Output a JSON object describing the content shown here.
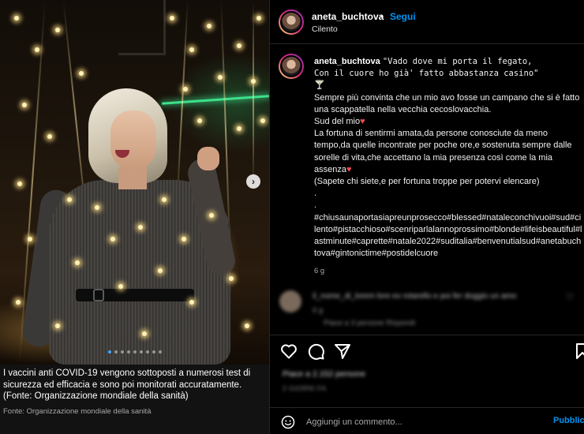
{
  "colors": {
    "background": "#000000",
    "link_blue": "#0095f6",
    "heart_red": "#ed4956",
    "muted_text": "#a8a8a8",
    "divider": "#262626"
  },
  "photo": {
    "description_icon": "carousel-next-icon",
    "carousel_count": 9,
    "carousel_active_index": 0
  },
  "info_banner": {
    "text": "I vaccini anti COVID-19 vengono sottoposti a numerosi test di sicurezza ed efficacia e sono poi monitorati accuratamente. (Fonte: Organizzazione mondiale della sanità)",
    "source": "Fonte: Organizzazione mondiale della sanità"
  },
  "header": {
    "username": "aneta_buchtova",
    "separator": "•",
    "follow_label": "Segui",
    "location": "Cilento"
  },
  "caption": {
    "username": "aneta_buchtova",
    "quote_line1": "\"Vado dove mi porta il fegato,",
    "quote_line2": "Con il cuore ho già' fatto abbastanza casino\"",
    "paragraph1": "Sempre più convinta che un mio avo fosse un campano che si è fatto una scappatella nella vecchia cecoslovacchia.",
    "paragraph2": "Sud del mio",
    "paragraph3": "La fortuna di sentirmi amata,da persone conosciute da meno tempo,da quelle incontrate per poche ore,e sostenuta sempre dalle sorelle di vita,che accettano la mia presenza così come la mia assenza",
    "paragraph4": "(Sapete chi siete,e per fortuna troppe per potervi elencare)",
    "dot1": ".",
    "dot2": ".",
    "hashtags": "#chiusaunaportasiapreunprosecco#blessed#nataleconchivuoi#sud#cilento#pistacchioso#scenriparlalannoprossimo#blonde#lifeisbeautiful#lastminute#caprette#natale2022#suditalia#benvenutialsud#anetabuchtova#gintonictime#postidelcuore",
    "time": "6 g"
  },
  "comment": {
    "line1": "il_nome_di_lorem lore ex rotarello e poi fer doggio un amo",
    "line2": "6 g",
    "line3": "Piace a 3 persone     Rispondi"
  },
  "actions": {
    "like_icon": "heart-icon",
    "comment_icon": "comment-icon",
    "share_icon": "share-icon",
    "save_icon": "bookmark-icon",
    "likes_text": "Piace a 2.152 persone",
    "date_text": "2 GIORNI FA"
  },
  "comment_box": {
    "emoji_icon": "emoji-icon",
    "placeholder": "Aggiungi un commento...",
    "publish_label": "Pubblica"
  }
}
